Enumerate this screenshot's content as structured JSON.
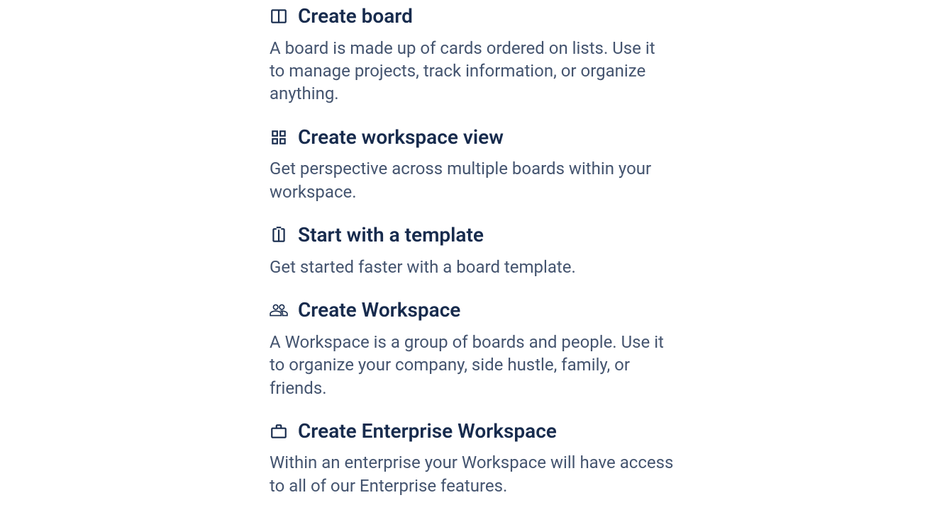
{
  "menu": {
    "items": [
      {
        "title": "Create board",
        "description": "A board is made up of cards ordered on lists. Use it to manage projects, track information, or organize anything."
      },
      {
        "title": "Create workspace view",
        "description": "Get perspective across multiple boards within your workspace."
      },
      {
        "title": "Start with a template",
        "description": "Get started faster with a board template."
      },
      {
        "title": "Create Workspace",
        "description": "A Workspace is a group of boards and people. Use it to organize your company, side hustle, family, or friends."
      },
      {
        "title": "Create Enterprise Workspace",
        "description": "Within an enterprise your Workspace will have access to all of our Enterprise features."
      }
    ]
  }
}
